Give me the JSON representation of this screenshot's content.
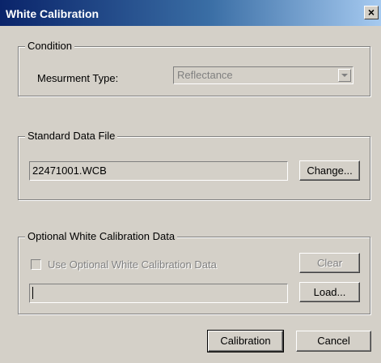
{
  "window": {
    "title": "White Calibration",
    "close_glyph": "×"
  },
  "condition": {
    "group_label": "Condition",
    "measurement_type_label": "Mesurment Type:",
    "measurement_type_value": "Reflectance"
  },
  "standard_data_file": {
    "group_label": "Standard Data File",
    "file_value": "22471001.WCB",
    "change_button": "Change..."
  },
  "optional_data": {
    "group_label": "Optional White Calibration Data",
    "checkbox_label": "Use Optional White Calibration Data",
    "checkbox_checked": false,
    "clear_button": "Clear",
    "file_value": "",
    "load_button": "Load..."
  },
  "footer": {
    "calibration_button": "Calibration",
    "cancel_button": "Cancel"
  }
}
